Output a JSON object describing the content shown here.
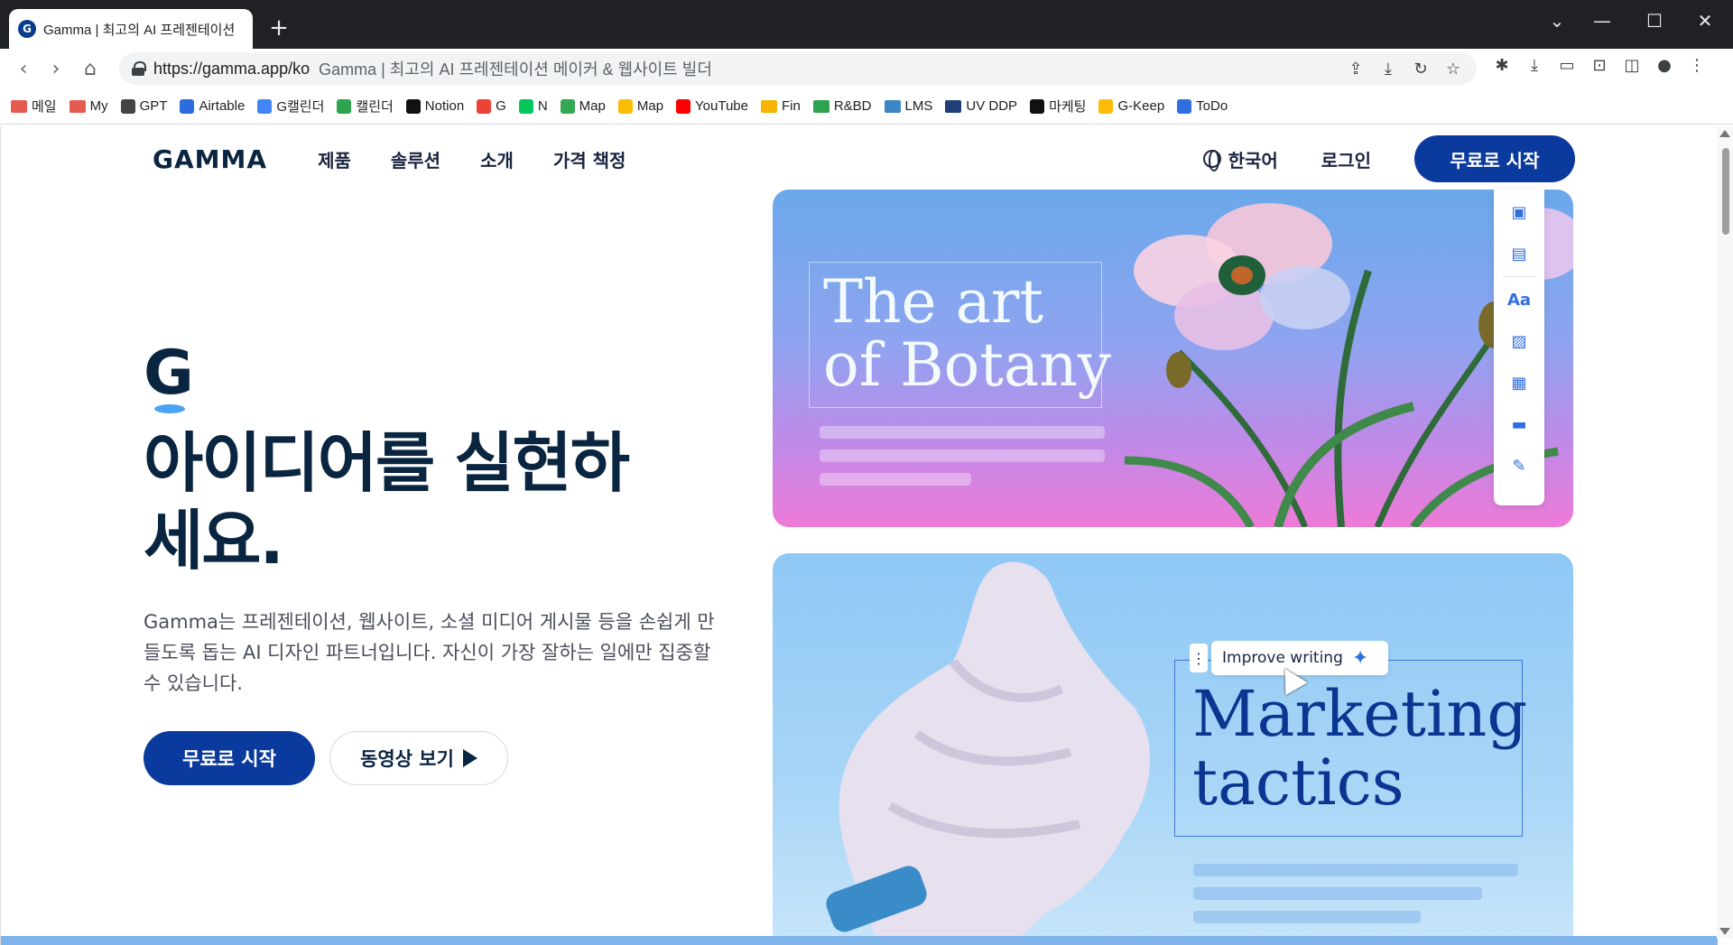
{
  "browser": {
    "tab_title": "Gamma | 최고의 AI 프레젠테이션",
    "new_tab": "+",
    "url": "https://gamma.app/ko",
    "url_title": "Gamma | 최고의 AI 프레젠테이션 메이커 & 웹사이트 빌더",
    "bookmarks": [
      {
        "label": "메일",
        "color": "#e55b4d",
        "kind": "folder"
      },
      {
        "label": "My",
        "color": "#e55b4d",
        "kind": "folder"
      },
      {
        "label": "GPT",
        "color": "#444444",
        "kind": "icon"
      },
      {
        "label": "Airtable",
        "color": "#2d6cdf",
        "kind": "icon"
      },
      {
        "label": "G캘린더",
        "color": "#4285f4",
        "kind": "icon"
      },
      {
        "label": "캘린더",
        "color": "#2ea44f",
        "kind": "icon"
      },
      {
        "label": "Notion",
        "color": "#111111",
        "kind": "icon"
      },
      {
        "label": "G",
        "color": "#ea4335",
        "kind": "icon"
      },
      {
        "label": "N",
        "color": "#03c75a",
        "kind": "icon"
      },
      {
        "label": "Map",
        "color": "#34a853",
        "kind": "icon"
      },
      {
        "label": "Map",
        "color": "#fbbc05",
        "kind": "icon"
      },
      {
        "label": "YouTube",
        "color": "#ff0000",
        "kind": "icon"
      },
      {
        "label": "Fin",
        "color": "#f6b400",
        "kind": "folder"
      },
      {
        "label": "R&BD",
        "color": "#2ea44f",
        "kind": "folder"
      },
      {
        "label": "LMS",
        "color": "#3d85c6",
        "kind": "folder"
      },
      {
        "label": "UV DDP",
        "color": "#1f3f7a",
        "kind": "folder"
      },
      {
        "label": "마케팅",
        "color": "#111111",
        "kind": "icon"
      },
      {
        "label": "G-Keep",
        "color": "#fbbc05",
        "kind": "icon"
      },
      {
        "label": "ToDo",
        "color": "#2f6fe0",
        "kind": "icon"
      }
    ]
  },
  "site": {
    "logo": "GAMMA",
    "nav": [
      "제품",
      "솔루션",
      "소개",
      "가격 책정"
    ],
    "lang": "한국어",
    "login": "로그인",
    "cta": "무료로 시작"
  },
  "hero": {
    "mark": "G",
    "headline_line1": "아이디어를 실현하",
    "headline_line2": "세요.",
    "sub": "Gamma는 프레젠테이션, 웹사이트, 소셜 미디어 게시물 등을 손쉽게 만들도록 돕는 AI 디자인 파트너입니다. 자신이 가장 잘하는 일에만 집중할 수 있습니다.",
    "primary": "무료로 시작",
    "secondary": "동영상 보기"
  },
  "cards": {
    "card1_title_line1": "The art",
    "card1_title_line2": "of Botany",
    "card2_title_line1": "Marketing",
    "card2_title_line2": "tactics",
    "improve": "Improve writing"
  },
  "side_panel": [
    "Aa"
  ]
}
